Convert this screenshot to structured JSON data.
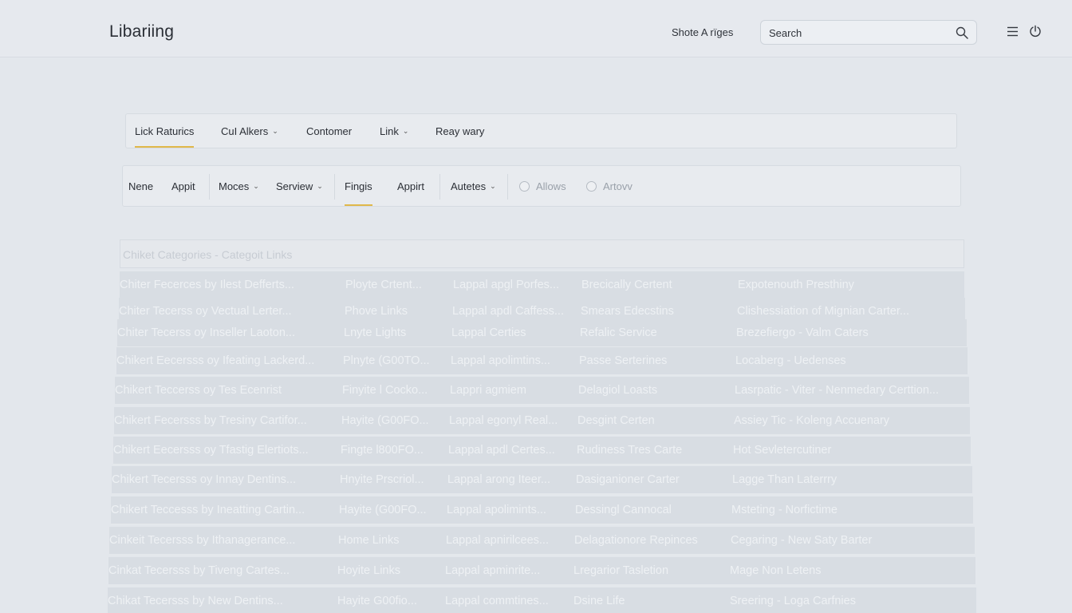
{
  "header": {
    "brand": "Libariing",
    "link": "Shote A rïges",
    "search_placeholder": "Search",
    "icons": [
      "search-icon",
      "menu-icon",
      "power-icon"
    ]
  },
  "tabs_primary": [
    {
      "label": "Lick Raturics",
      "dropdown": false,
      "active": true
    },
    {
      "label": "CuI Alkers",
      "dropdown": true,
      "active": false
    },
    {
      "label": "Contomer",
      "dropdown": false,
      "active": false
    },
    {
      "label": "Link",
      "dropdown": true,
      "active": false
    },
    {
      "label": "Reay wary",
      "dropdown": false,
      "active": false
    }
  ],
  "tabs_secondary": [
    {
      "label": "Nene",
      "dropdown": false,
      "active": false
    },
    {
      "label": "Appit",
      "dropdown": false,
      "active": false
    },
    {
      "label": "Moces",
      "dropdown": true,
      "active": false
    },
    {
      "label": "Serview",
      "dropdown": true,
      "active": false
    },
    {
      "label": "Fingis",
      "dropdown": false,
      "active": true
    },
    {
      "label": "Appirt",
      "dropdown": false,
      "active": false
    },
    {
      "label": "Autetes",
      "dropdown": true,
      "active": false
    }
  ],
  "radio_options": [
    "Allows",
    "Artovv"
  ],
  "table": {
    "header": "Chiket Categories - Categoit Links",
    "rows": [
      [
        "Chiter Fecerces by Ilest Defferts...",
        "Ployte Crtent...",
        "Lappal apgl Porfes...",
        "Brecically Certent",
        "Expotenouth Presthiny"
      ],
      [
        "Chiter Tecerss oy Vectual Lerter...",
        "Phove Links",
        "Lappal apdl Caffess...",
        "Smears Edecstins",
        "Clishessiation of Mignian Carter..."
      ],
      [
        "Chiter Tecerss oy Inseller Laoton...",
        "Lnyte Lights",
        "Lappal Certies",
        "Refalic Service",
        "Brezefiergo - Valm Caters"
      ],
      [
        "Chikert Eecersss oy Ifeating Lackerd...",
        "Plnyte (G00TO...",
        "Lappal apolimtins...",
        "Passe Serterines",
        "Locaberg - Uedenses"
      ],
      [
        "Chikert Teccerss oy Tes Ecenrist",
        "Finyite l Cocko...",
        "Lappri agmiem",
        "Delagiol Loasts",
        "Lasrpatic - Viter - Nenmedary Certtion..."
      ],
      [
        "Chikert Fecersss by Tresiny Cartifor...",
        "Hayite (G00FO...",
        "Lappal egonyl Real...",
        "Desgint Certen",
        "Assiey Tic - Koleng Accuenary"
      ],
      [
        "Chikert Eecersss oy Tfastig Elertiots...",
        "Fingte l800FO...",
        "Lappal apdl Certes...",
        "Rudiness Tres Carte",
        "Hot Sevletercutiner"
      ],
      [
        "Chikert Tecersss oy Innay Dentins...",
        "Hnyite Prscriol...",
        "Lappal arong Iteer...",
        "Dasiganioner Carter",
        "Lagge Than Laterrry"
      ],
      [
        "Chikert Teccesss by Ineatting Cartin...",
        "Hayite (G00FO...",
        "Lappal apolimints...",
        "Dessingl Cannocal",
        "Msteting - Norfictime"
      ],
      [
        "Cinkeit Tecersss by Ithanagerance...",
        "Home Links",
        "Lappal apnirilcees...",
        "Delagationore Repinces",
        "Cegaring - New Saty Barter"
      ],
      [
        "Cinkat Tecersss by Tiveng Cartes...",
        "Hoyite Links",
        "Lappal apminrite...",
        "Lregarior Tasletion",
        "Mage Non Letens"
      ],
      [
        "Chikat Tecersss by New Dentins...",
        "Hayite G00fio...",
        "Lappal commtines...",
        "Dsine Life",
        "Sreering - Loga Carfnies"
      ]
    ]
  }
}
